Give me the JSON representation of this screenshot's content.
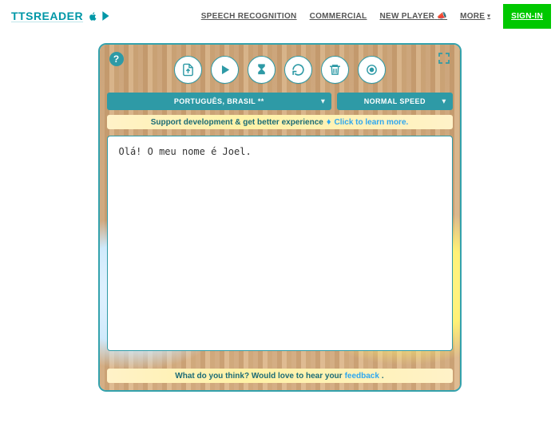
{
  "header": {
    "logo": "TTSREADER",
    "nav": {
      "speech": "SPEECH RECOGNITION",
      "commercial": "COMMERCIAL",
      "new_player": "NEW PLAYER",
      "more": "MORE",
      "signin": "SIGN-IN"
    }
  },
  "toolbar": {
    "buttons": {
      "upload": "upload-file-icon",
      "play": "play-icon",
      "timer": "hourglass-icon",
      "reload": "reload-icon",
      "trash": "trash-icon",
      "record": "record-icon"
    }
  },
  "selects": {
    "language": "PORTUGUÊS, BRASIL **",
    "speed": "NORMAL SPEED"
  },
  "promo": {
    "text": "Support development & get better experience",
    "cta": "Click to learn more."
  },
  "textarea": {
    "value": "Olá! O meu nome é Joel."
  },
  "footer": {
    "text": "What do you think? Would love to hear your ",
    "link": "feedback",
    "period": "."
  }
}
